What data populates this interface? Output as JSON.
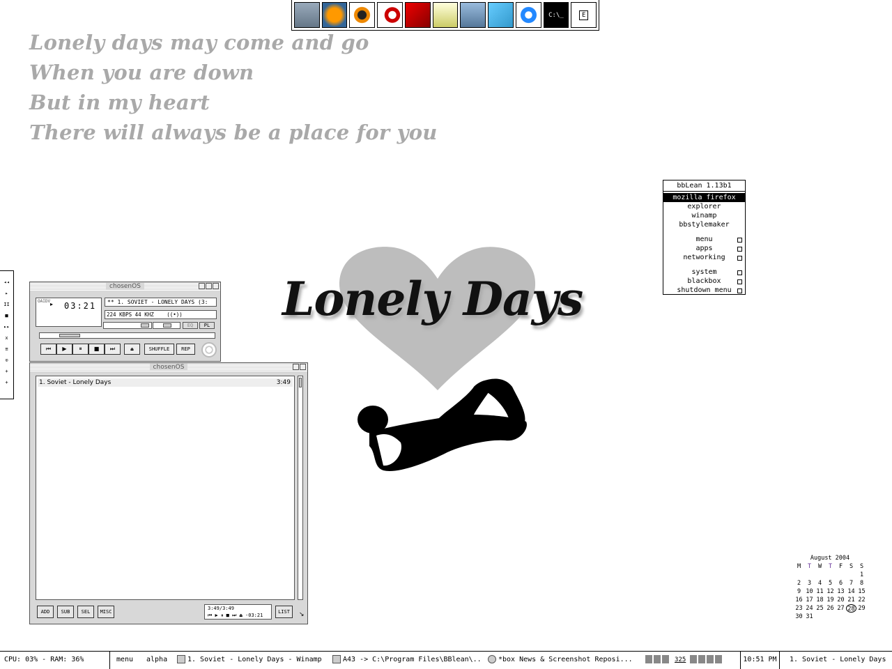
{
  "lyrics": [
    "Lonely days may come and go",
    "When you are down",
    "But in my heart",
    "There will always be a place for you"
  ],
  "toolbar": {
    "icons": [
      "my-computer-icon",
      "firefox-icon",
      "reason-icon",
      "cubase-icon",
      "red-app-icon",
      "paint-icon",
      "notepad-icon",
      "registry-icon",
      "internet-explorer-icon",
      "command-prompt-icon",
      "e-box-icon"
    ],
    "cmd_label": "C:\\_",
    "last_label": "E"
  },
  "art": {
    "title": "Lonely Days"
  },
  "bbmenu": {
    "title": "bbLean 1.13b1",
    "items": [
      "mozilla firefox",
      "explorer",
      "winamp",
      "bbstylemaker"
    ],
    "submenus1": [
      "menu",
      "apps",
      "networking"
    ],
    "submenus2": [
      "system",
      "blackbox",
      "shutdown menu"
    ]
  },
  "dock": {
    "glyphs": [
      "◂◂",
      "▸",
      "II",
      "■",
      "▸▸",
      "x",
      "≡",
      "⊙",
      "+",
      "+"
    ]
  },
  "winamp": {
    "title": "chosenOS",
    "time": "03:21",
    "song": "** 1. SOVIET - LONELY DAYS (3:",
    "bitrate": "224",
    "kbps": "KBPS",
    "khz_val": "44",
    "khz": "KHZ",
    "stereo": "((•))",
    "eq": "EQ",
    "pl": "PL",
    "shuffle": "SHUFFLE",
    "rep": "REP",
    "vis_letters": "OAIDV"
  },
  "playlist": {
    "title": "chosenOS",
    "entries": [
      {
        "name": "1. Soviet - Lonely Days",
        "dur": "3:49"
      }
    ],
    "btn_add": "ADD",
    "btn_sub": "SUB",
    "btn_sel": "SEL",
    "btn_misc": "MISC",
    "btn_list": "LIST",
    "time_info": "3:49/3:49",
    "remaining": "-03:21"
  },
  "calendar": {
    "month": "August 2004",
    "days": [
      "M",
      "T",
      "W",
      "T",
      "F",
      "S",
      "S"
    ],
    "dates": [
      "",
      "",
      "",
      "",
      "",
      "",
      "1",
      "2",
      "3",
      "4",
      "5",
      "6",
      "7",
      "8",
      "9",
      "10",
      "11",
      "12",
      "13",
      "14",
      "15",
      "16",
      "17",
      "18",
      "19",
      "20",
      "21",
      "22",
      "23",
      "24",
      "25",
      "26",
      "27",
      "28",
      "29",
      "30",
      "31"
    ],
    "today": "28"
  },
  "taskbar": {
    "cpu": "CPU: 03% - RAM: 36%",
    "menu": "menu",
    "workspace": "alpha",
    "tasks": [
      "1. Soviet - Lonely Days - Winamp",
      "A43 -> C:\\Program Files\\BBlean\\...",
      "*box News & Screenshot Reposi..."
    ],
    "clock": "10:51 PM",
    "now_playing": "1. Soviet - Lonely Days",
    "tray_count": "325"
  }
}
